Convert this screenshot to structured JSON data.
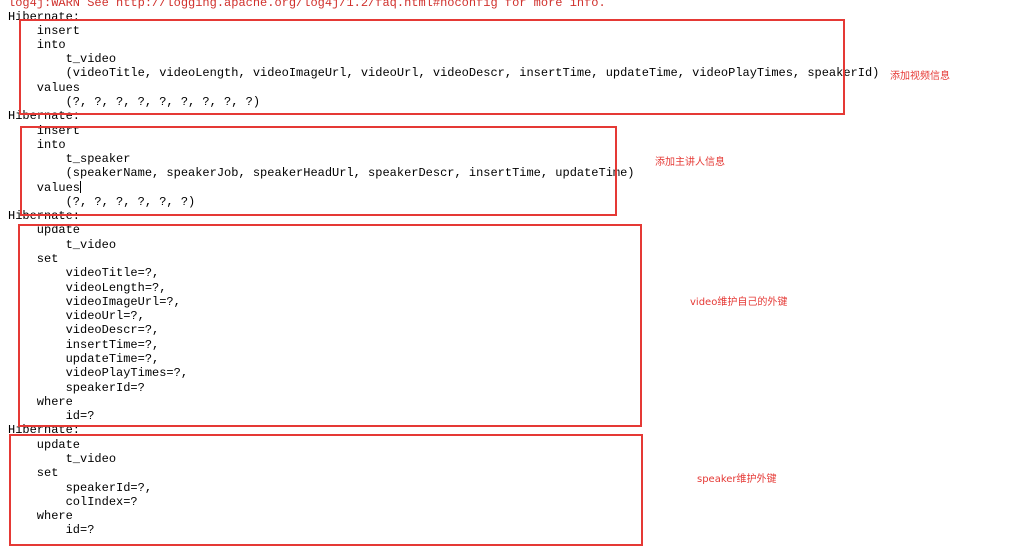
{
  "console": {
    "lines": [
      "log4j:WARN See http://logging.apache.org/log4j/1.2/faq.html#noconfig for more info.",
      "Hibernate:",
      "    insert",
      "    into",
      "        t_video",
      "        (videoTitle, videoLength, videoImageUrl, videoUrl, videoDescr, insertTime, updateTime, videoPlayTimes, speakerId)",
      "    values",
      "        (?, ?, ?, ?, ?, ?, ?, ?, ?)",
      "Hibernate:",
      "    insert",
      "    into",
      "        t_speaker",
      "        (speakerName, speakerJob, speakerHeadUrl, speakerDescr, insertTime, updateTime)",
      "    values",
      "        (?, ?, ?, ?, ?, ?)",
      "Hibernate:",
      "    update",
      "        t_video",
      "    set",
      "        videoTitle=?,",
      "        videoLength=?,",
      "        videoImageUrl=?,",
      "        videoUrl=?,",
      "        videoDescr=?,",
      "        insertTime=?,",
      "        updateTime=?,",
      "        videoPlayTimes=?,",
      "        speakerId=?",
      "    where",
      "        id=?",
      "Hibernate:",
      "    update",
      "        t_video",
      "    set",
      "        speakerId=?,",
      "        colIndex=?",
      "    where",
      "        id=?"
    ]
  },
  "annotations": {
    "video_insert": "添加视频信息",
    "speaker_insert": "添加主讲人信息",
    "video_fk": "video维护自己的外键",
    "speaker_fk": "speaker维护外键"
  },
  "colors": {
    "annotation_red": "#e53935",
    "warn_red": "#d0312d"
  }
}
